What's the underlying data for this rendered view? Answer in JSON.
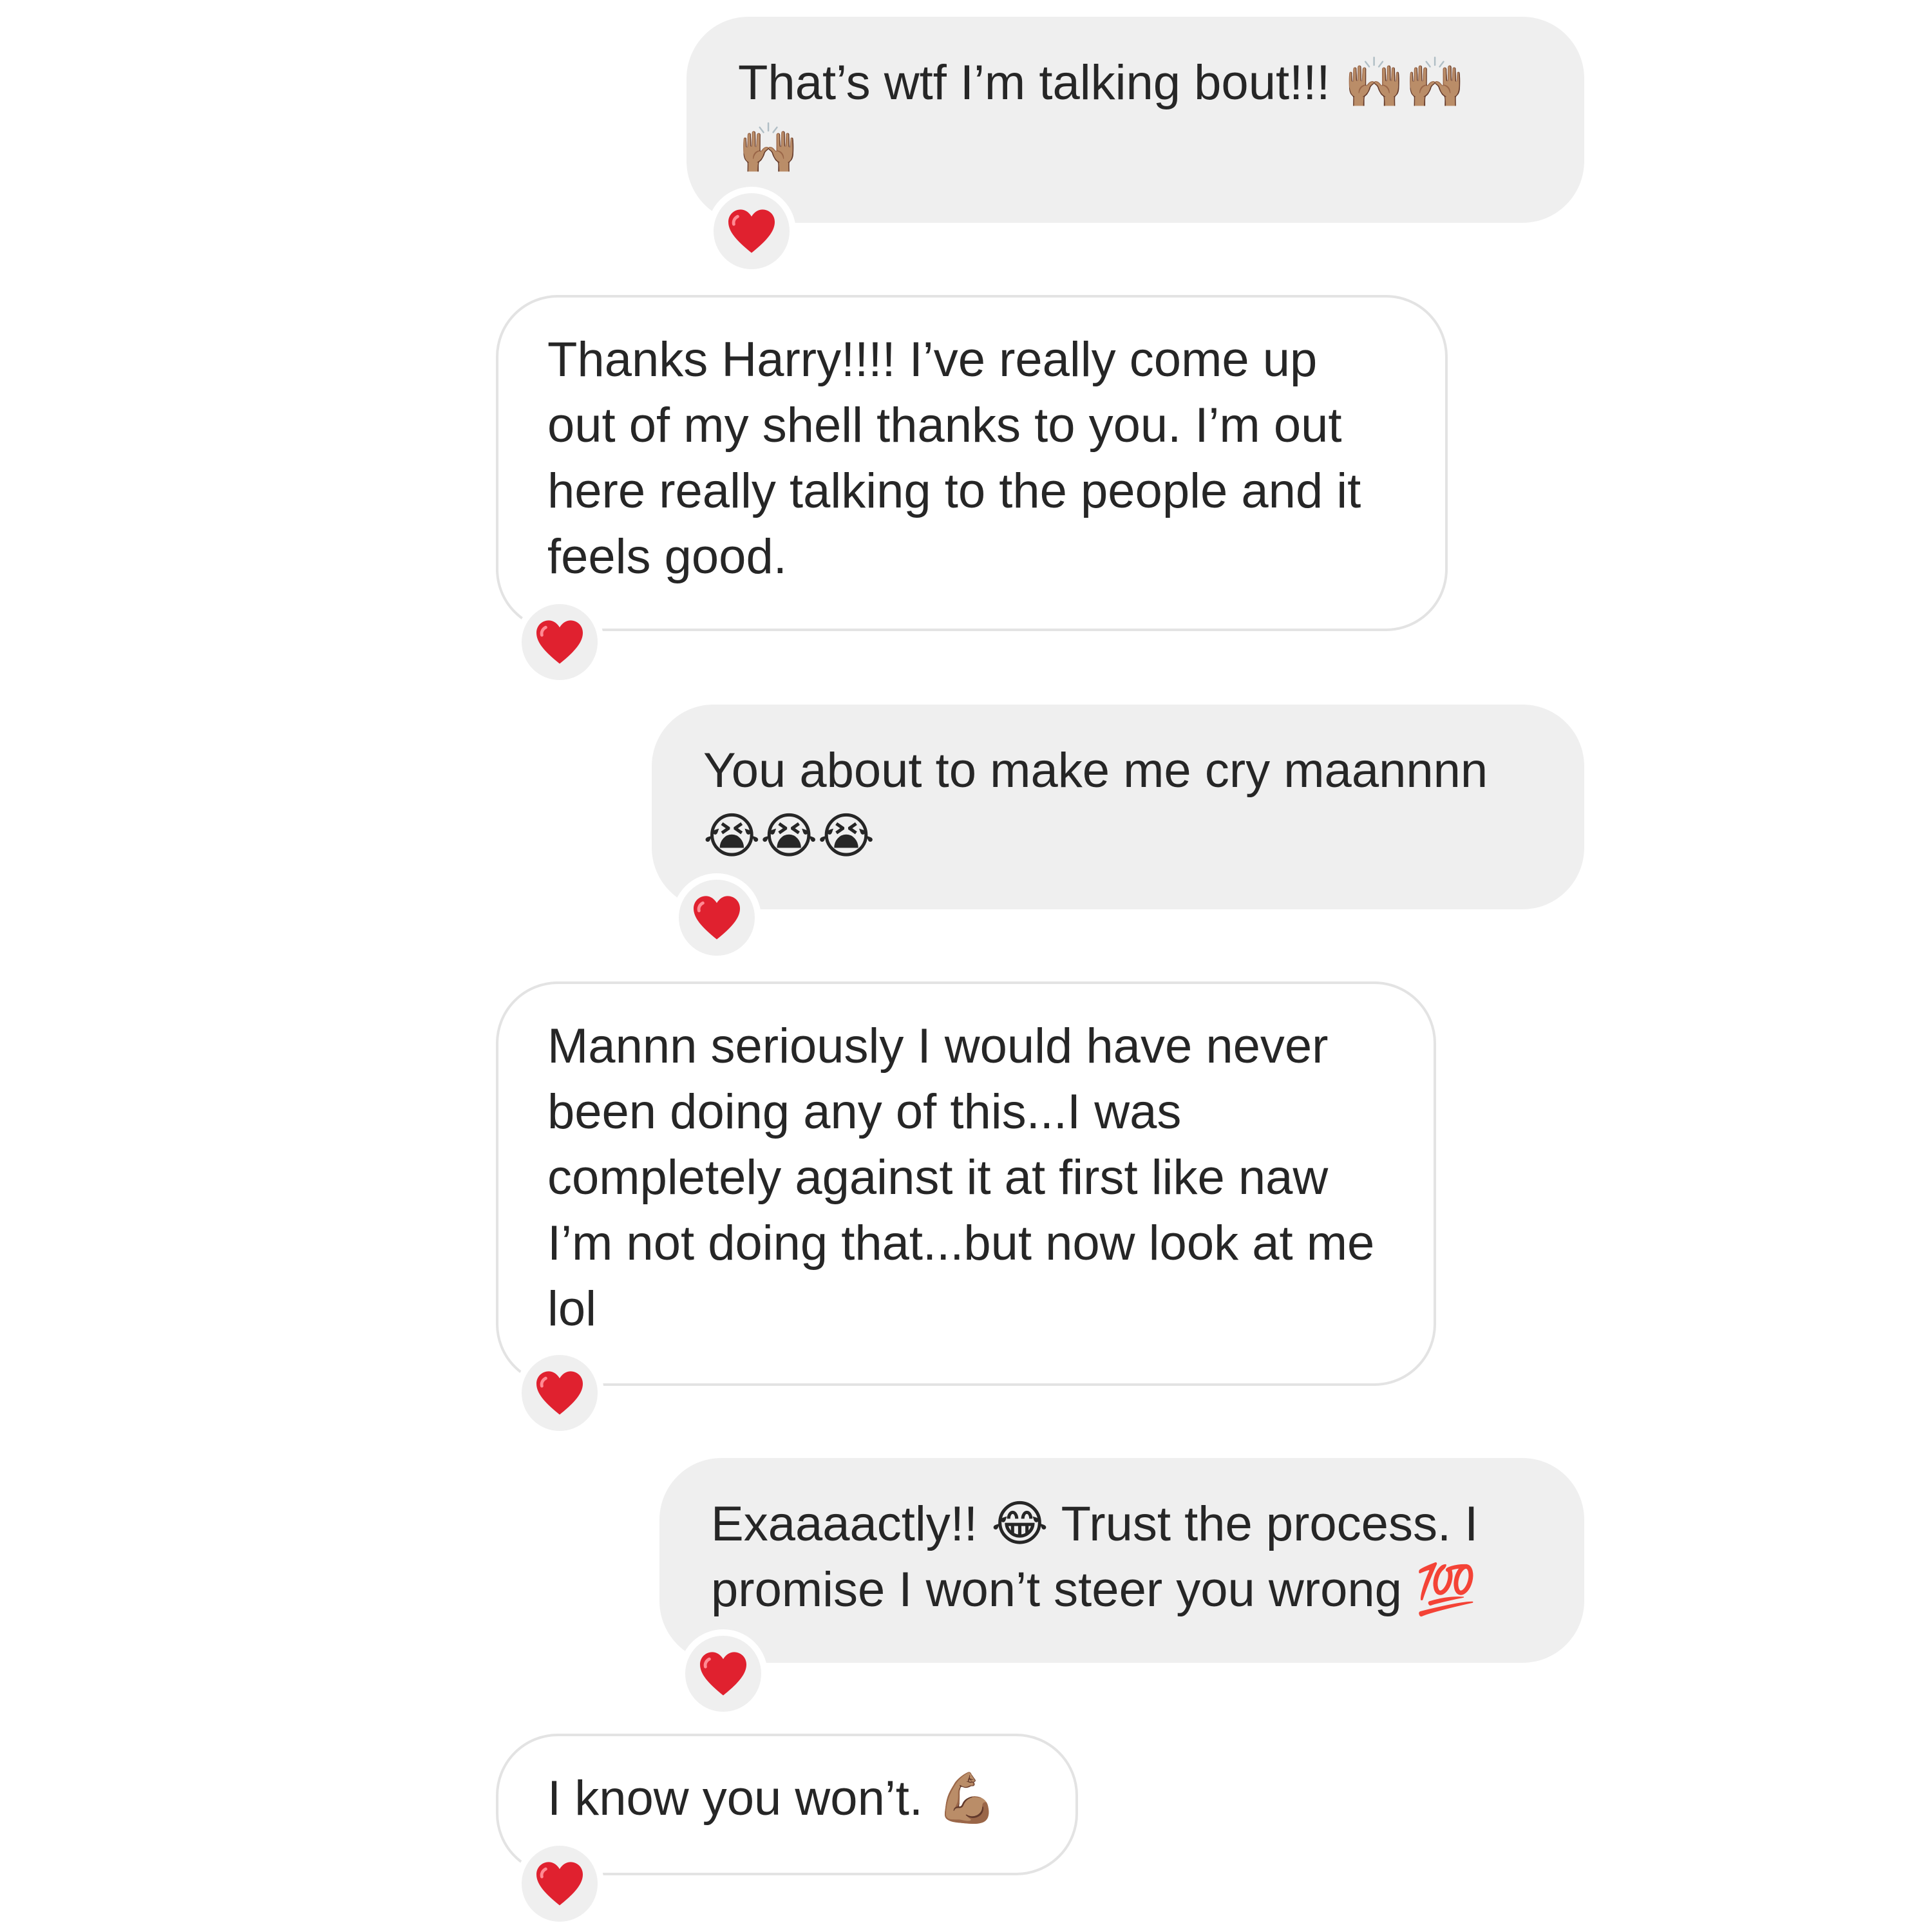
{
  "messages": [
    {
      "direction": "outgoing",
      "text": "That’s wtf I’m talking bout!!! 🙌🏽🙌🏽 🙌🏽",
      "reaction": "heart"
    },
    {
      "direction": "incoming",
      "text": "Thanks Harry!!!! I’ve really come up out of my shell thanks to you. I’m out here really talking to the people and it feels good.",
      "reaction": "heart"
    },
    {
      "direction": "outgoing",
      "text": "You about to make me cry maannnn 😭😭😭",
      "reaction": "heart"
    },
    {
      "direction": "incoming",
      "text": "Mannn seriously I would have never been doing any of this...I was completely against it at first like naw I’m not doing that...but now look at me lol",
      "reaction": "heart"
    },
    {
      "direction": "outgoing",
      "text": "Exaaaactly!! 😂 Trust the process. I promise I won’t steer you wrong 💯",
      "reaction": "heart"
    },
    {
      "direction": "incoming",
      "text": "I know you won’t. 💪🏽",
      "reaction": "heart"
    }
  ],
  "colors": {
    "outgoing_bubble": "#efefef",
    "incoming_bubble_border": "#e3e3e3",
    "text": "#262626",
    "heart": "#e0212f"
  }
}
